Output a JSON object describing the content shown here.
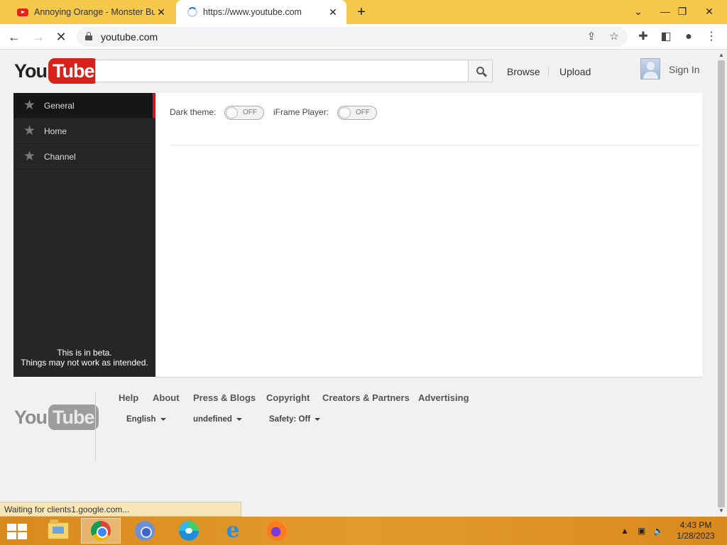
{
  "browser": {
    "tabs": [
      {
        "title": "Annoying Orange - Monster Burp",
        "active": false
      },
      {
        "title": "https://www.youtube.com",
        "active": true
      }
    ],
    "new_tab_icon": "+",
    "window_controls": {
      "chevron": "⌄",
      "minimize": "—",
      "restore": "❐",
      "close": "✕"
    },
    "url": "youtube.com",
    "status_text": "Waiting for clients1.google.com..."
  },
  "youtube": {
    "logo": {
      "you": "You",
      "tube": "Tube"
    },
    "search": {
      "value": "",
      "placeholder": ""
    },
    "header_links": {
      "browse": "Browse",
      "upload": "Upload",
      "sign_in": "Sign In"
    },
    "sidebar": {
      "items": [
        {
          "label": "General",
          "active": true
        },
        {
          "label": "Home",
          "active": false
        },
        {
          "label": "Channel",
          "active": false
        }
      ],
      "beta_line1": "This is in beta.",
      "beta_line2": "Things may not work as intended."
    },
    "settings": {
      "dark_theme_label": "Dark theme:",
      "dark_theme_state": "OFF",
      "iframe_label": "iFrame Player:",
      "iframe_state": "OFF"
    },
    "footer": {
      "links": [
        "Help",
        "About",
        "Press & Blogs",
        "Copyright",
        "Creators & Partners",
        "Advertising"
      ],
      "language": "English",
      "location": "undefined",
      "safety": "Safety: Off"
    }
  },
  "taskbar": {
    "time": "4:43 PM",
    "date": "1/28/2023"
  },
  "colors": {
    "tab_strip": "#f6c84c",
    "youtube_red": "#d6221b",
    "sidebar_bg": "#262626",
    "taskbar": "#e39a2c"
  }
}
